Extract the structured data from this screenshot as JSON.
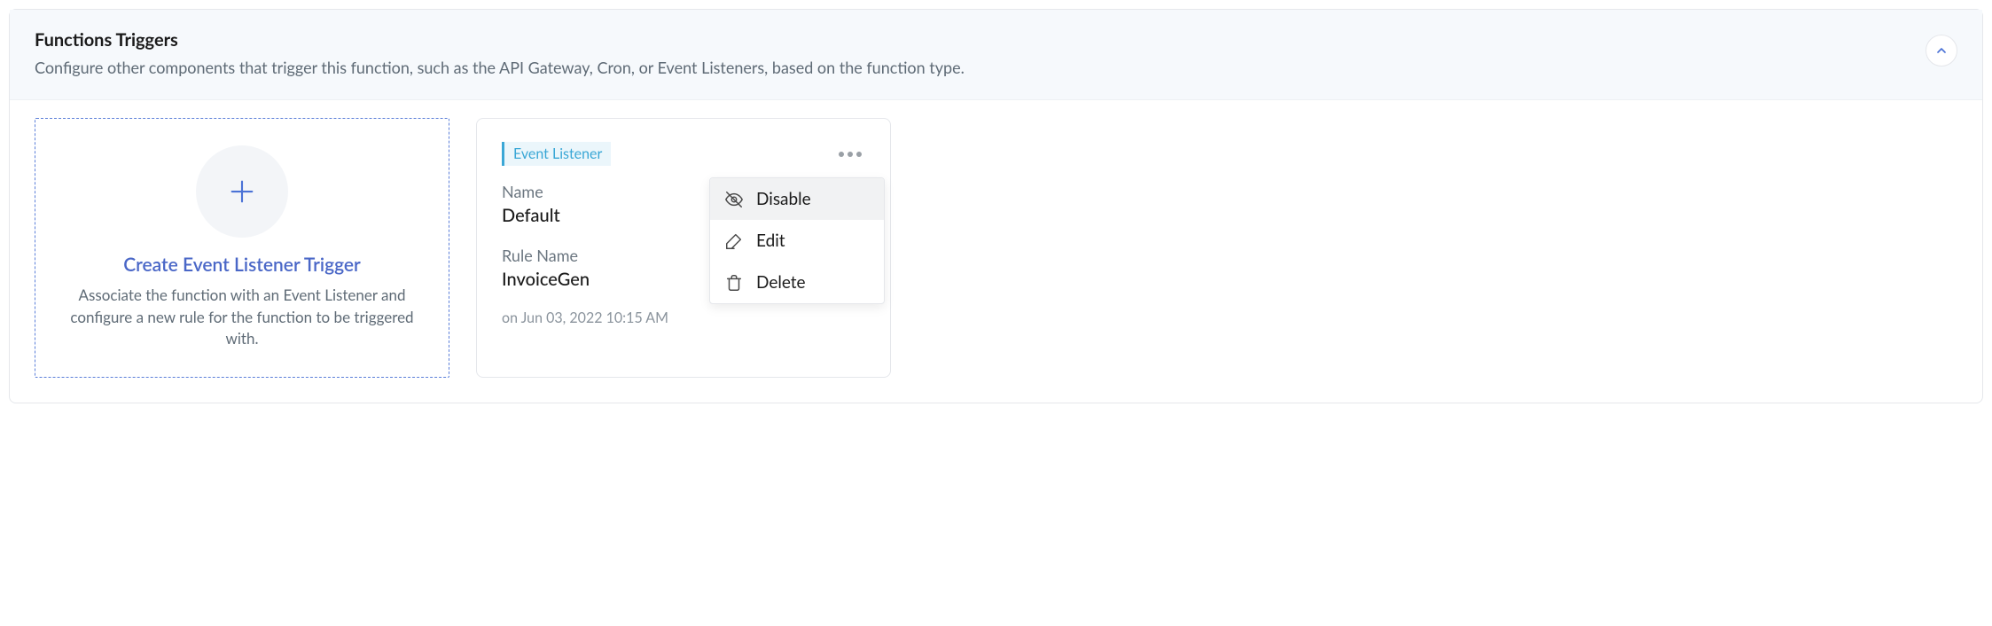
{
  "panel": {
    "title": "Functions Triggers",
    "description": "Configure other components that trigger this function, such as the API Gateway, Cron, or Event Listeners, based on the function type."
  },
  "create_card": {
    "title": "Create Event Listener Trigger",
    "description": "Associate the function with an Event Listener and configure a new rule for the function to be triggered with."
  },
  "trigger": {
    "tag": "Event Listener",
    "name_label": "Name",
    "name_value": "Default",
    "rule_label": "Rule Name",
    "rule_value": "InvoiceGen",
    "timestamp": "on Jun 03, 2022 10:15 AM"
  },
  "menu": {
    "disable": "Disable",
    "edit": "Edit",
    "delete": "Delete"
  }
}
